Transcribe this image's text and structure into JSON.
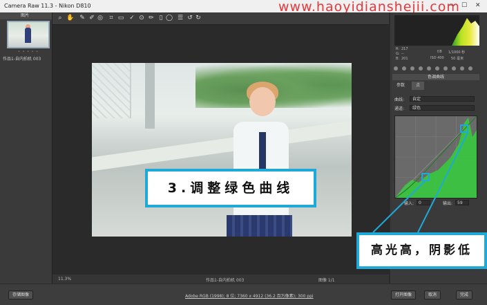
{
  "window": {
    "title": "Camera Raw 11.3 - Nikon D810",
    "watermark": "www.haoyidianshejii.com"
  },
  "filmstrip": {
    "header": "图片",
    "stars": "• • • • •",
    "caption": "作品1-自内拍机 003"
  },
  "toolbar": {
    "icons": [
      "zoom-icon",
      "hand-icon",
      "white-balance-icon",
      "color-sampler-icon",
      "target-adjust-icon",
      "crop-icon",
      "straighten-icon",
      "spot-removal-icon",
      "redeye-icon",
      "adjustment-brush-icon",
      "graduated-filter-icon",
      "radial-filter-icon",
      "preferences-icon",
      "rotate-left-icon",
      "rotate-right-icon"
    ]
  },
  "canvas": {
    "caption": "3.调整绿色曲线"
  },
  "statusbar": {
    "zoom": "11.3%",
    "filename": "作品1-自内拍机 003",
    "pager": "图像 1/1"
  },
  "histogram_info": {
    "r_label": "R:",
    "g_label": "G:",
    "b_label": "B:",
    "r_value": "217",
    "g_value": "--",
    "b_value": "201",
    "aperture": "f/8",
    "shutter": "1/1000 秒",
    "iso": "ISO 400",
    "lens": "50 毫米"
  },
  "panel": {
    "title": "色调曲线",
    "tabs": [
      "参数",
      "点"
    ],
    "selected_tab": 1,
    "curve_label": "曲线:",
    "curve_value": "自定",
    "channel_label": "通道:",
    "channel_value": "绿色",
    "input_label": "输入:",
    "input_value": "0",
    "output_label": "输出:",
    "output_value": "59"
  },
  "annotation": {
    "note": "高光高，阴影低"
  },
  "bottombar": {
    "save_label": "存储图像",
    "link_text": "Adobe RGB (1998); 8 位; 7360 x 4912 (36.2 百万像素); 300 ppi",
    "open_label": "打开图像",
    "cancel_label": "取消",
    "done_label": "完成"
  },
  "colors": {
    "highlight": "#1fa9d8",
    "watermark": "#e3393c"
  }
}
